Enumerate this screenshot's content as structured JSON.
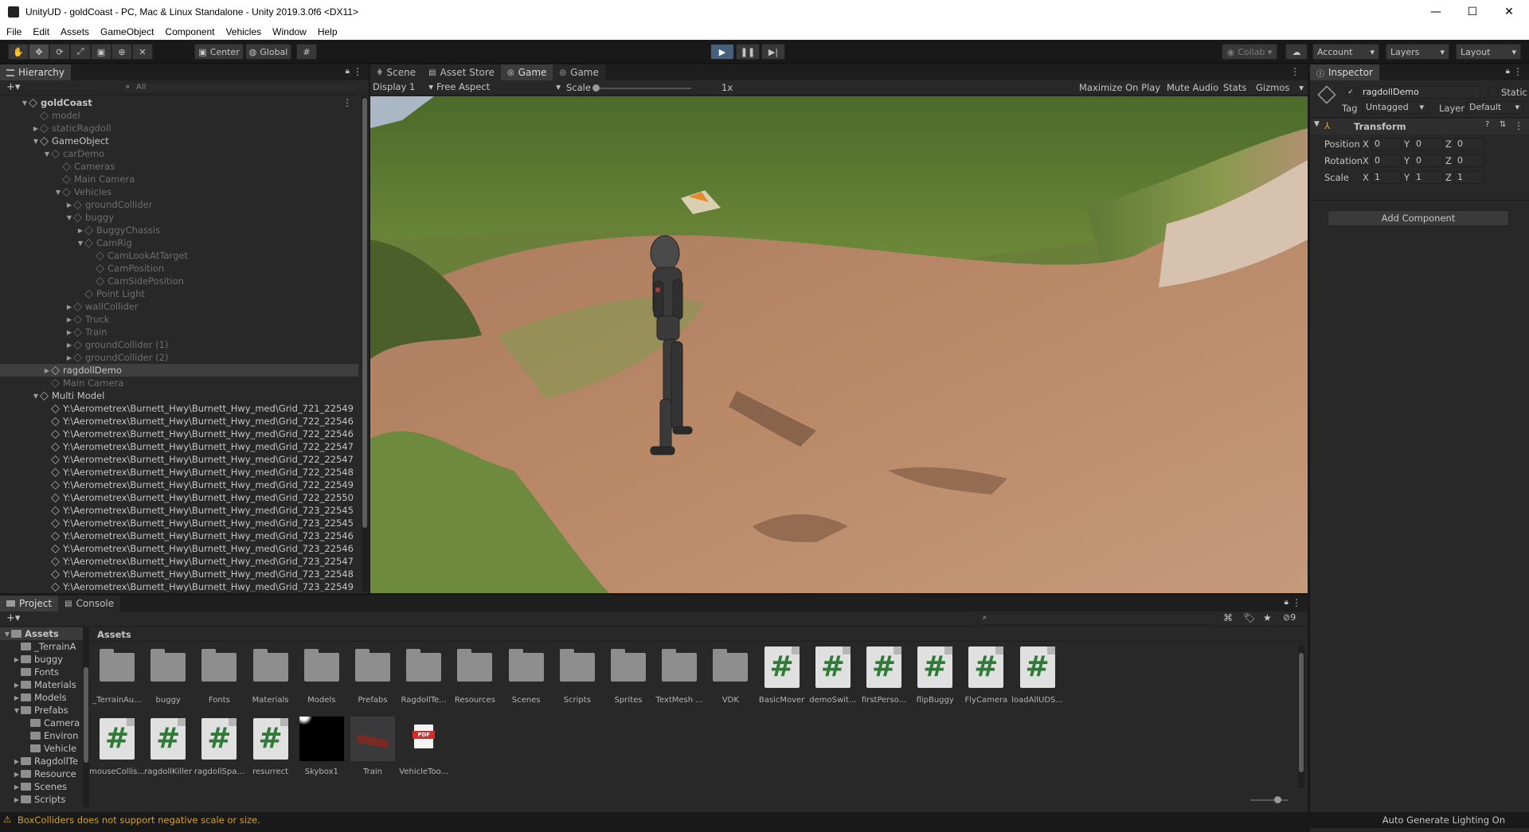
{
  "window": {
    "title": "UnityUD - goldCoast - PC, Mac & Linux Standalone - Unity 2019.3.0f6 <DX11>",
    "controls": {
      "minimize": "—",
      "maximize": "☐",
      "close": "✕"
    }
  },
  "menu": [
    "File",
    "Edit",
    "Assets",
    "GameObject",
    "Component",
    "Vehicles",
    "Window",
    "Help"
  ],
  "toolbar": {
    "pivot_label": "Center",
    "space_label": "Global",
    "collab_label": "Collab ▾",
    "account_label": "Account",
    "layers_label": "Layers",
    "layout_label": "Layout"
  },
  "hierarchy": {
    "tab_label": "Hierarchy",
    "search_placeholder": "All",
    "add_label": "+▾",
    "rows": [
      {
        "label": "goldCoast",
        "indent": 0,
        "arrow": "▼",
        "dim": false,
        "bold": true,
        "scene": true
      },
      {
        "label": "model",
        "indent": 1,
        "arrow": "",
        "dim": true
      },
      {
        "label": "staticRagdoll",
        "indent": 1,
        "arrow": "▶",
        "dim": true
      },
      {
        "label": "GameObject",
        "indent": 1,
        "arrow": "▼",
        "dim": false
      },
      {
        "label": "carDemo",
        "indent": 2,
        "arrow": "▼",
        "dim": true
      },
      {
        "label": "Cameras",
        "indent": 3,
        "arrow": "",
        "dim": true
      },
      {
        "label": "Main Camera",
        "indent": 3,
        "arrow": "",
        "dim": true
      },
      {
        "label": "Vehicles",
        "indent": 3,
        "arrow": "▼",
        "dim": true
      },
      {
        "label": "groundCollider",
        "indent": 4,
        "arrow": "▶",
        "dim": true
      },
      {
        "label": "buggy",
        "indent": 4,
        "arrow": "▼",
        "dim": true
      },
      {
        "label": "BuggyChassis",
        "indent": 5,
        "arrow": "▶",
        "dim": true
      },
      {
        "label": "CamRig",
        "indent": 5,
        "arrow": "▼",
        "dim": true
      },
      {
        "label": "CamLookAtTarget",
        "indent": 6,
        "arrow": "",
        "dim": true
      },
      {
        "label": "CamPosition",
        "indent": 6,
        "arrow": "",
        "dim": true
      },
      {
        "label": "CamSidePosition",
        "indent": 6,
        "arrow": "",
        "dim": true
      },
      {
        "label": "Point Light",
        "indent": 5,
        "arrow": "",
        "dim": true
      },
      {
        "label": "wallCollider",
        "indent": 4,
        "arrow": "▶",
        "dim": true
      },
      {
        "label": "Truck",
        "indent": 4,
        "arrow": "▶",
        "dim": true
      },
      {
        "label": "Train",
        "indent": 4,
        "arrow": "▶",
        "dim": true
      },
      {
        "label": "groundCollider (1)",
        "indent": 4,
        "arrow": "▶",
        "dim": true
      },
      {
        "label": "groundCollider (2)",
        "indent": 4,
        "arrow": "▶",
        "dim": true
      },
      {
        "label": "ragdollDemo",
        "indent": 2,
        "arrow": "▶",
        "dim": false,
        "hl": true
      },
      {
        "label": "Main Camera",
        "indent": 2,
        "arrow": "",
        "dim": true
      },
      {
        "label": "Multi Model",
        "indent": 1,
        "arrow": "▼",
        "dim": false
      },
      {
        "label": "Y:\\Aerometrex\\Burnett_Hwy\\Burnett_Hwy_med\\Grid_721_22549",
        "indent": 2,
        "arrow": "",
        "dim": false
      },
      {
        "label": "Y:\\Aerometrex\\Burnett_Hwy\\Burnett_Hwy_med\\Grid_722_22546",
        "indent": 2,
        "arrow": "",
        "dim": false
      },
      {
        "label": "Y:\\Aerometrex\\Burnett_Hwy\\Burnett_Hwy_med\\Grid_722_22546",
        "indent": 2,
        "arrow": "",
        "dim": false
      },
      {
        "label": "Y:\\Aerometrex\\Burnett_Hwy\\Burnett_Hwy_med\\Grid_722_22547",
        "indent": 2,
        "arrow": "",
        "dim": false
      },
      {
        "label": "Y:\\Aerometrex\\Burnett_Hwy\\Burnett_Hwy_med\\Grid_722_22547",
        "indent": 2,
        "arrow": "",
        "dim": false
      },
      {
        "label": "Y:\\Aerometrex\\Burnett_Hwy\\Burnett_Hwy_med\\Grid_722_22548",
        "indent": 2,
        "arrow": "",
        "dim": false
      },
      {
        "label": "Y:\\Aerometrex\\Burnett_Hwy\\Burnett_Hwy_med\\Grid_722_22549",
        "indent": 2,
        "arrow": "",
        "dim": false
      },
      {
        "label": "Y:\\Aerometrex\\Burnett_Hwy\\Burnett_Hwy_med\\Grid_722_22550",
        "indent": 2,
        "arrow": "",
        "dim": false
      },
      {
        "label": "Y:\\Aerometrex\\Burnett_Hwy\\Burnett_Hwy_med\\Grid_723_22545",
        "indent": 2,
        "arrow": "",
        "dim": false
      },
      {
        "label": "Y:\\Aerometrex\\Burnett_Hwy\\Burnett_Hwy_med\\Grid_723_22545",
        "indent": 2,
        "arrow": "",
        "dim": false
      },
      {
        "label": "Y:\\Aerometrex\\Burnett_Hwy\\Burnett_Hwy_med\\Grid_723_22546",
        "indent": 2,
        "arrow": "",
        "dim": false
      },
      {
        "label": "Y:\\Aerometrex\\Burnett_Hwy\\Burnett_Hwy_med\\Grid_723_22546",
        "indent": 2,
        "arrow": "",
        "dim": false
      },
      {
        "label": "Y:\\Aerometrex\\Burnett_Hwy\\Burnett_Hwy_med\\Grid_723_22547",
        "indent": 2,
        "arrow": "",
        "dim": false
      },
      {
        "label": "Y:\\Aerometrex\\Burnett_Hwy\\Burnett_Hwy_med\\Grid_723_22548",
        "indent": 2,
        "arrow": "",
        "dim": false
      },
      {
        "label": "Y:\\Aerometrex\\Burnett_Hwy\\Burnett_Hwy_med\\Grid_723_22549",
        "indent": 2,
        "arrow": "",
        "dim": false
      }
    ]
  },
  "center": {
    "tabs": [
      "Scene",
      "Asset Store",
      "Game",
      "Game"
    ],
    "display_label": "Display 1",
    "aspect_label": "Free Aspect",
    "scale_label": "Scale",
    "scale_value": "1x",
    "maximize_label": "Maximize On Play",
    "mute_label": "Mute Audio",
    "stats_label": "Stats",
    "gizmos_label": "Gizmos"
  },
  "inspector": {
    "tab_label": "Inspector",
    "object_name": "ragdollDemo",
    "static_label": "Static",
    "tag_label": "Tag",
    "tag_value": "Untagged",
    "layer_label": "Layer",
    "layer_value": "Default",
    "transform_label": "Transform",
    "position_label": "Position",
    "rotation_label": "Rotation",
    "scale_label": "Scale",
    "axes": [
      "X",
      "Y",
      "Z"
    ],
    "position": [
      "0",
      "0",
      "0"
    ],
    "rotation": [
      "0",
      "0",
      "0"
    ],
    "scale": [
      "1",
      "1",
      "1"
    ],
    "add_component_label": "Add Component"
  },
  "project": {
    "tabs": [
      "Project",
      "Console"
    ],
    "add_label": "+▾",
    "breadcrumb": "Assets",
    "hidden_count": "9",
    "tree": [
      {
        "label": "Assets",
        "indent": 0,
        "arrow": "▼",
        "bold": true
      },
      {
        "label": "_TerrainA",
        "indent": 1,
        "arrow": ""
      },
      {
        "label": "buggy",
        "indent": 1,
        "arrow": "▶"
      },
      {
        "label": "Fonts",
        "indent": 1,
        "arrow": ""
      },
      {
        "label": "Materials",
        "indent": 1,
        "arrow": "▶"
      },
      {
        "label": "Models",
        "indent": 1,
        "arrow": "▶"
      },
      {
        "label": "Prefabs",
        "indent": 1,
        "arrow": "▼"
      },
      {
        "label": "Camera",
        "indent": 2,
        "arrow": ""
      },
      {
        "label": "Environ",
        "indent": 2,
        "arrow": ""
      },
      {
        "label": "Vehicle",
        "indent": 2,
        "arrow": ""
      },
      {
        "label": "RagdollTe",
        "indent": 1,
        "arrow": "▶"
      },
      {
        "label": "Resource",
        "indent": 1,
        "arrow": "▶"
      },
      {
        "label": "Scenes",
        "indent": 1,
        "arrow": "▶"
      },
      {
        "label": "Scripts",
        "indent": 1,
        "arrow": "▶"
      }
    ],
    "assets": [
      {
        "label": "_TerrainAu...",
        "kind": "folder"
      },
      {
        "label": "buggy",
        "kind": "folder"
      },
      {
        "label": "Fonts",
        "kind": "folder"
      },
      {
        "label": "Materials",
        "kind": "folder"
      },
      {
        "label": "Models",
        "kind": "folder"
      },
      {
        "label": "Prefabs",
        "kind": "folder"
      },
      {
        "label": "RagdollTe...",
        "kind": "folder"
      },
      {
        "label": "Resources",
        "kind": "folder"
      },
      {
        "label": "Scenes",
        "kind": "folder"
      },
      {
        "label": "Scripts",
        "kind": "folder"
      },
      {
        "label": "Sprites",
        "kind": "folder"
      },
      {
        "label": "TextMesh ...",
        "kind": "folder"
      },
      {
        "label": "VDK",
        "kind": "folder"
      },
      {
        "label": "BasicMover",
        "kind": "script"
      },
      {
        "label": "demoSwit...",
        "kind": "script"
      },
      {
        "label": "firstPerso...",
        "kind": "script"
      },
      {
        "label": "flipBuggy",
        "kind": "script"
      },
      {
        "label": "FlyCamera",
        "kind": "script"
      },
      {
        "label": "loadAllUDS...",
        "kind": "script"
      },
      {
        "label": "mouseCollis...",
        "kind": "script"
      },
      {
        "label": "ragdollKiller",
        "kind": "script"
      },
      {
        "label": "ragdollSpa...",
        "kind": "script"
      },
      {
        "label": "resurrect",
        "kind": "script"
      },
      {
        "label": "Skybox1",
        "kind": "skybox"
      },
      {
        "label": "Train",
        "kind": "model"
      },
      {
        "label": "VehicleToo...",
        "kind": "pdf"
      }
    ],
    "pdf_badge": "PDF"
  },
  "status": {
    "warning": "BoxColliders does not support negative scale or size.",
    "right": "Auto Generate Lighting On"
  }
}
